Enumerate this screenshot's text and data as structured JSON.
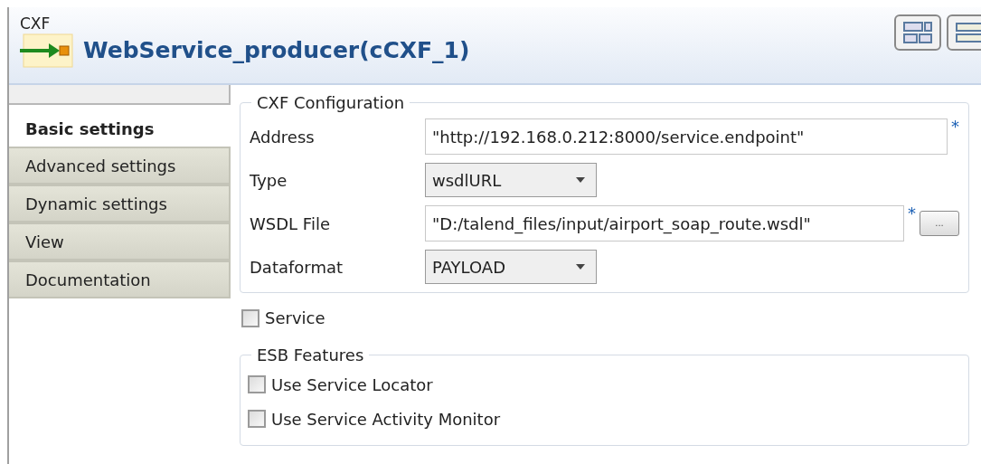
{
  "header": {
    "category": "CXF",
    "title": "WebService_producer(cCXF_1)"
  },
  "tabs": [
    {
      "label": "Basic settings",
      "selected": true
    },
    {
      "label": "Advanced settings",
      "selected": false
    },
    {
      "label": "Dynamic settings",
      "selected": false
    },
    {
      "label": "View",
      "selected": false
    },
    {
      "label": "Documentation",
      "selected": false
    }
  ],
  "cxf_configuration": {
    "legend": "CXF Configuration",
    "fields": [
      {
        "kind": "text",
        "label": "Address",
        "value": "\"http://192.168.0.212:8000/service.endpoint\"",
        "required": "*"
      },
      {
        "kind": "select",
        "label": "Type",
        "value": "wsdlURL"
      },
      {
        "kind": "file",
        "label": "WSDL File",
        "value": "\"D:/talend_files/input/airport_soap_route.wsdl\"",
        "required": "*",
        "button": "..."
      },
      {
        "kind": "select",
        "label": "Dataformat",
        "value": "PAYLOAD"
      }
    ]
  },
  "service": {
    "label": "Service",
    "checked": false
  },
  "esb_features": {
    "legend": "ESB Features",
    "options": [
      {
        "label": "Use Service Locator",
        "checked": false
      },
      {
        "label": "Use Service Activity Monitor",
        "checked": false
      }
    ]
  }
}
